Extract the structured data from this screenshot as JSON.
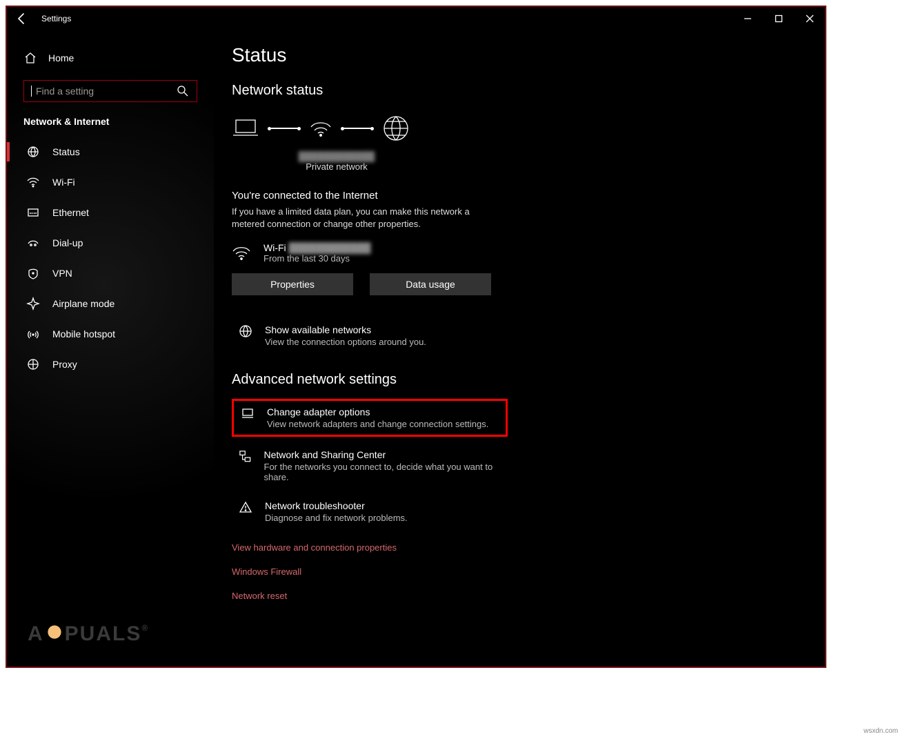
{
  "window": {
    "title": "Settings"
  },
  "sidebar": {
    "home": "Home",
    "search_placeholder": "Find a setting",
    "section": "Network & Internet",
    "items": [
      {
        "label": "Status",
        "icon": "globe-grid-icon",
        "active": true
      },
      {
        "label": "Wi-Fi",
        "icon": "wifi-icon"
      },
      {
        "label": "Ethernet",
        "icon": "ethernet-icon"
      },
      {
        "label": "Dial-up",
        "icon": "dialup-icon"
      },
      {
        "label": "VPN",
        "icon": "vpn-icon"
      },
      {
        "label": "Airplane mode",
        "icon": "airplane-icon"
      },
      {
        "label": "Mobile hotspot",
        "icon": "hotspot-icon"
      },
      {
        "label": "Proxy",
        "icon": "globe-icon"
      }
    ]
  },
  "main": {
    "title": "Status",
    "network_status_label": "Network status",
    "diagram": {
      "network_name": "████████████",
      "network_type": "Private network"
    },
    "connected": {
      "headline": "You're connected to the Internet",
      "desc": "If you have a limited data plan, you can make this network a metered connection or change other properties.",
      "conn_name": "Wi-Fi",
      "conn_name_blur": "████████████",
      "conn_sub": "From the last 30 days",
      "properties_btn": "Properties",
      "data_usage_btn": "Data usage"
    },
    "show_networks": {
      "title": "Show available networks",
      "desc": "View the connection options around you."
    },
    "advanced_label": "Advanced network settings",
    "adv_items": [
      {
        "title": "Change adapter options",
        "desc": "View network adapters and change connection settings.",
        "icon": "adapter-icon",
        "highlight": true
      },
      {
        "title": "Network and Sharing Center",
        "desc": "For the networks you connect to, decide what you want to share.",
        "icon": "sharing-center-icon"
      },
      {
        "title": "Network troubleshooter",
        "desc": "Diagnose and fix network problems.",
        "icon": "warning-icon"
      }
    ],
    "links": [
      "View hardware and connection properties",
      "Windows Firewall",
      "Network reset"
    ]
  },
  "watermark": {
    "brand": "APPUALS",
    "credit": "wsxdn.com"
  }
}
